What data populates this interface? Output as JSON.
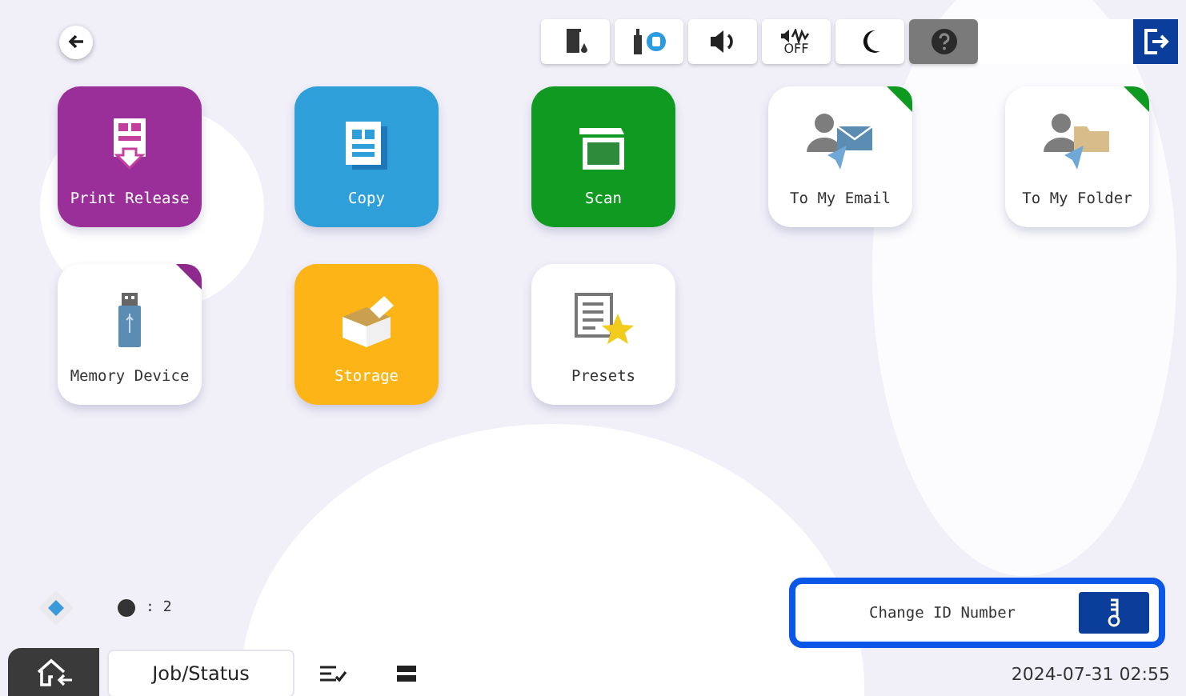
{
  "top_bar": {
    "status_buttons": [
      {
        "kind": "ink",
        "selected": false
      },
      {
        "kind": "device",
        "selected": false
      },
      {
        "kind": "volume",
        "selected": false
      },
      {
        "kind": "mute",
        "label": "OFF",
        "selected": false
      },
      {
        "kind": "sleep",
        "selected": false
      },
      {
        "kind": "help",
        "selected": true
      }
    ]
  },
  "tiles": [
    {
      "label": "Print Release",
      "kind": "print",
      "color": "#9b2f9a"
    },
    {
      "label": "Copy",
      "kind": "copy",
      "color": "#2e9fd9"
    },
    {
      "label": "Scan",
      "kind": "scan",
      "color": "#119a22"
    },
    {
      "label": "To My Email",
      "kind": "email",
      "color": "#ffffff",
      "corner": {
        "color": "#0e9a20"
      }
    },
    {
      "label": "To My Folder",
      "kind": "folder",
      "color": "#ffffff",
      "corner": {
        "color": "#0e9a20"
      }
    },
    {
      "label": "Memory Device",
      "kind": "usb",
      "color": "#ffffff",
      "corner": {
        "color": "#8e2a8e"
      }
    },
    {
      "label": "Storage",
      "kind": "storage",
      "color": "#fdb417"
    },
    {
      "label": "Presets",
      "kind": "presets",
      "color": "#ffffff"
    }
  ],
  "status_area": {
    "count": ": 2"
  },
  "id_panel": {
    "label": "Change ID Number"
  },
  "bottom_bar": {
    "job_status": "Job/Status",
    "datetime": "2024-07-31 02:55"
  }
}
